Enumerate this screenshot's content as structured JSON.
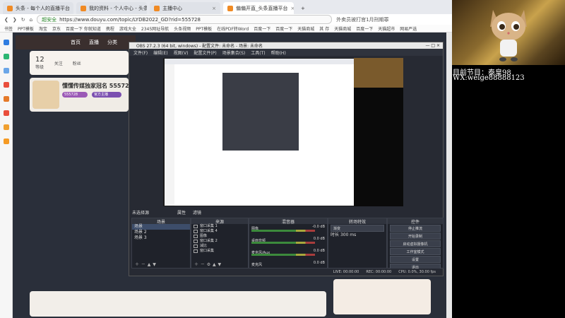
{
  "browser": {
    "tabs": [
      {
        "label": "头条 - 每个人的直播平台",
        "active": false
      },
      {
        "label": "我的资料 - 个人中心 - 头条",
        "active": false
      },
      {
        "label": "主播中心",
        "active": false
      },
      {
        "label": "偏偏开直_头条直播平台",
        "active": true
      }
    ],
    "new_tab": "+",
    "url": "https://www.douyu.com/topic/LYDB2022_GD?rid=555728",
    "url_security": "超安全",
    "search_hint": "外卖员被打官1月刑期罪",
    "bookmarks": [
      "书签",
      "PPT模板",
      "淘宝",
      "京东",
      "百度一下 你就知道",
      "携程",
      "游戏大全",
      "2345网址导航",
      "头条视频",
      "PPT模板",
      "在线PDF转Word",
      "百度一下",
      "百度一下",
      "天猫商城",
      "其 存",
      "天猫商城",
      "百度一下",
      "天猫超市",
      "网易严选"
    ]
  },
  "page": {
    "nav": [
      "首页",
      "直播",
      "分类"
    ],
    "stats": [
      {
        "value": "12",
        "label": "等级"
      },
      {
        "value": "",
        "label": "关注"
      },
      {
        "value": "",
        "label": "粉丝"
      }
    ],
    "room_title": "懂懂传媒独家冠名 555728",
    "room_tags": [
      "555728",
      "官方主播"
    ]
  },
  "obs": {
    "title": "OBS 27.2.3 (64 bit, windows) - 配置文件: 未命名 - 场景: 未命名",
    "menu": [
      "文件(F)",
      "编辑(E)",
      "视图(V)",
      "配置文件(P)",
      "场景集合(S)",
      "工具(T)",
      "帮助(H)"
    ],
    "scenes_label": "未选择源",
    "scene_buttons": [
      "属性",
      "滤镜"
    ],
    "docks": {
      "scenes": {
        "title": "场景",
        "items": [
          "场景",
          "场景 2",
          "场景 3"
        ],
        "selected": 0
      },
      "sources": {
        "title": "来源",
        "items": [
          "窗口采集 1",
          "窗口采集 4",
          "图像",
          "窗口采集 2",
          "减比",
          "窗口采集"
        ]
      },
      "mixer": {
        "title": "混音器",
        "channels": [
          {
            "label": "图像",
            "value": "-0.0 dB"
          },
          {
            "label": "桌面音频",
            "value": "0.0 dB"
          },
          {
            "label": "麦克风/Aux",
            "value": "0.0 dB"
          },
          {
            "label": "麦克风",
            "value": "0.0 dB"
          }
        ]
      },
      "transitions": {
        "title": "转场特效",
        "type": "渐变",
        "duration_label": "时长",
        "duration": "300 ms"
      },
      "controls": {
        "title": "控件",
        "buttons": [
          "停止推流",
          "开始录制",
          "启动虚拟摄像机",
          "工作室模式",
          "设置",
          "退出"
        ]
      }
    },
    "status": {
      "live": "LIVE: 00:00:00",
      "rec": "REC: 00:00:00",
      "cpu": "CPU: 0.0%, 30.00 fps"
    }
  },
  "overlay": {
    "line1": "目前节目：泰皇98",
    "line2": "WX:weige88888123"
  }
}
